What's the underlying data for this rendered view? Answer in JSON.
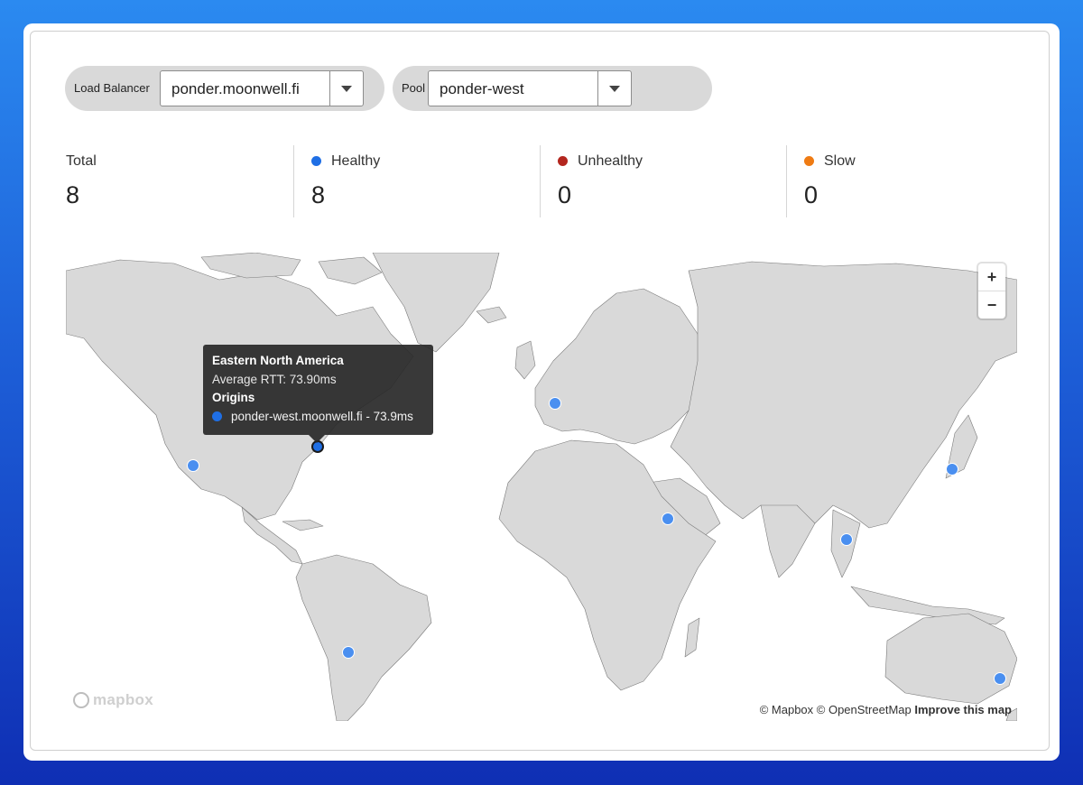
{
  "controls": {
    "load_balancer": {
      "label": "Load Balancer",
      "value": "ponder.moonwell.fi"
    },
    "pool": {
      "label": "Pool",
      "value": "ponder-west"
    }
  },
  "stats": [
    {
      "label": "Total",
      "value": "8",
      "dot": ""
    },
    {
      "label": "Healthy",
      "value": "8",
      "dot": "#1f6fe5"
    },
    {
      "label": "Unhealthy",
      "value": "0",
      "dot": "#b3261e"
    },
    {
      "label": "Slow",
      "value": "0",
      "dot": "#ef7b13"
    }
  ],
  "map": {
    "zoom_in": "+",
    "zoom_out": "−",
    "logo_text": "mapbox",
    "attribution": "© Mapbox © OpenStreetMap",
    "improve": "Improve this map",
    "tooltip": {
      "title": "Eastern North America",
      "rtt": "Average RTT: 73.90ms",
      "origins_label": "Origins",
      "origin_item": "ponder-west.moonwell.fi - 73.9ms"
    },
    "marker_color": "#4a8ff0"
  }
}
